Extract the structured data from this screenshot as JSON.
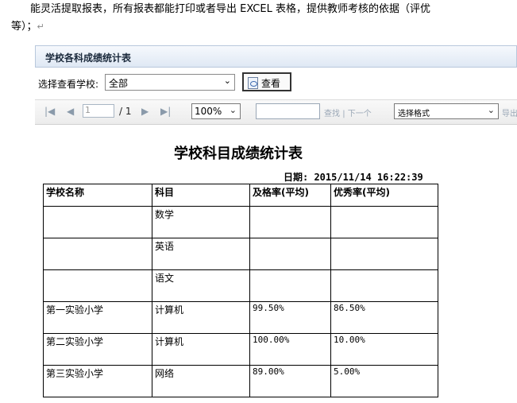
{
  "doc": {
    "line1": "能灵活提取报表，所有报表都能打印或者导出 EXCEL 表格，提供教师考核的依据（评优",
    "line2": "等）；",
    "return_mark": "↵"
  },
  "panel": {
    "title": "学校各科成绩统计表"
  },
  "filter": {
    "label": "选择查看学校:",
    "school_value": "全部",
    "view_button": "查看"
  },
  "toolbar": {
    "first": "|◀",
    "prev": "◀",
    "page_value": "1",
    "page_total": "/ 1",
    "next": "▶",
    "last": "▶|",
    "zoom": "100%",
    "find": "查找",
    "separator": "|",
    "next_match": "下一个",
    "format": "选择格式",
    "export": "导出"
  },
  "report": {
    "title": "学校科目成绩统计表",
    "date": "日期: 2015/11/14  16:22:39",
    "columns": [
      "学校名称",
      "科目",
      "及格率(平均)",
      "优秀率(平均)"
    ],
    "rows": [
      [
        "",
        "数学",
        "",
        ""
      ],
      [
        "",
        "英语",
        "",
        ""
      ],
      [
        "",
        "语文",
        "",
        ""
      ],
      [
        "第一实验小学",
        "计算机",
        "99.50%",
        "86.50%"
      ],
      [
        "第二实验小学",
        "计算机",
        "100.00%",
        "10.00%"
      ],
      [
        "第三实验小学",
        "网络",
        "89.00%",
        "5.00%"
      ]
    ]
  }
}
